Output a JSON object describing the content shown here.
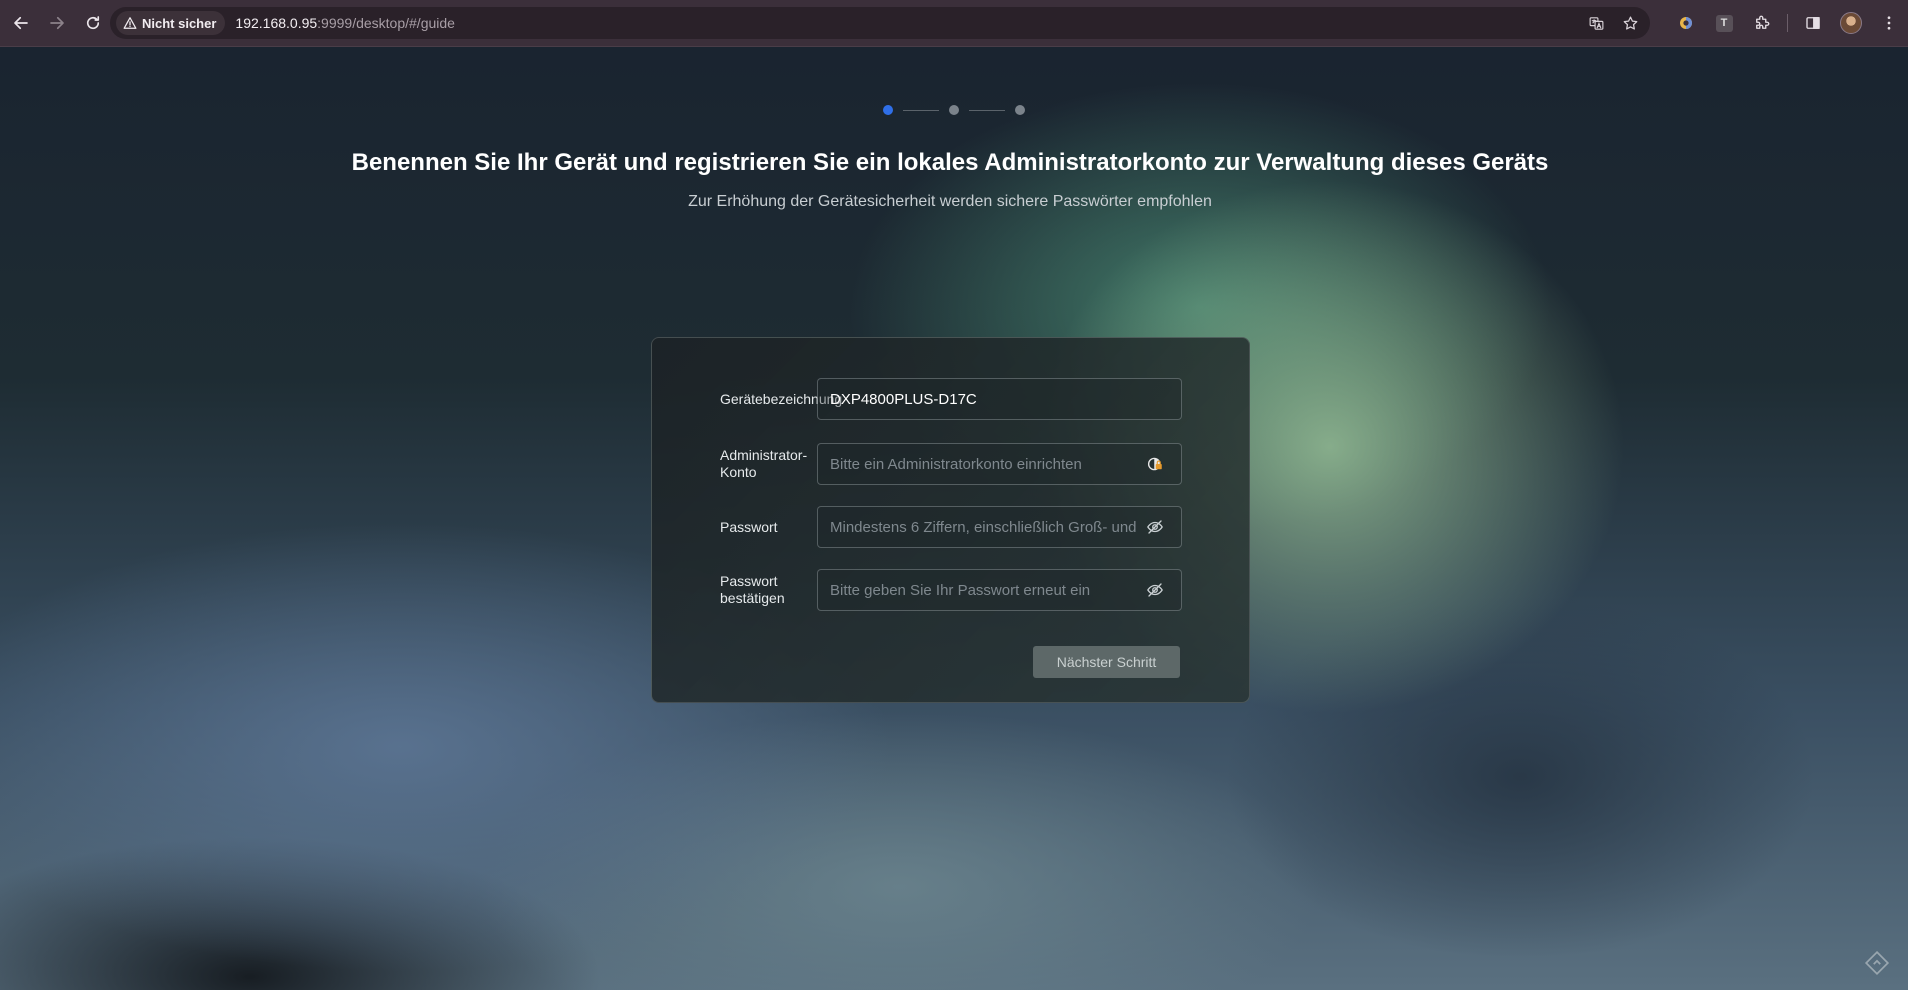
{
  "browser": {
    "security_label": "Nicht sicher",
    "url_host": "192.168.0.95",
    "url_rest": ":9999/desktop/#/guide",
    "extension_letter": "T"
  },
  "stepper": {
    "total_steps": 3,
    "current_step": 1,
    "active_color": "#2f6fe8"
  },
  "main": {
    "title": "Benennen Sie Ihr Gerät und registrieren Sie ein lokales Administratorkonto zur Verwaltung dieses Geräts",
    "subtitle": "Zur Erhöhung der Gerätesicherheit werden sichere Passwörter empfohlen"
  },
  "form": {
    "device_name": {
      "label": "Gerätebezeichnung",
      "value": "DXP4800PLUS-D17C"
    },
    "admin_account": {
      "label": "Administrator-Konto",
      "placeholder": "Bitte ein Administratorkonto einrichten",
      "icon": "password-manager-icon"
    },
    "password": {
      "label": "Passwort",
      "placeholder": "Mindestens 6 Ziffern, einschließlich Groß- und",
      "icon": "eye-hidden-icon"
    },
    "confirm_password": {
      "label": "Passwort bestätigen",
      "placeholder": "Bitte geben Sie Ihr Passwort erneut ein",
      "icon": "eye-hidden-icon"
    },
    "next_button_label": "Nächster Schritt"
  },
  "icons": {
    "back": "back-arrow-icon",
    "forward": "forward-arrow-icon",
    "reload": "reload-icon",
    "warning": "warning-triangle-icon",
    "translate": "translate-icon",
    "bookmark": "star-icon",
    "extensions": "puzzle-icon",
    "sidebar": "side-panel-icon",
    "menu": "kebab-menu-icon"
  }
}
